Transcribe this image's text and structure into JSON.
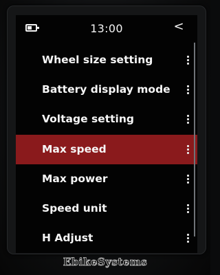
{
  "status_bar": {
    "time": "13:00",
    "battery_icon": "battery-icon",
    "back_icon": "chevron-left-icon",
    "back_glyph": "<"
  },
  "menu": {
    "items": [
      {
        "label": "Wheel size setting",
        "selected": false
      },
      {
        "label": "Battery display mode",
        "selected": false
      },
      {
        "label": "Voltage setting",
        "selected": false
      },
      {
        "label": "Max speed",
        "selected": true
      },
      {
        "label": "Max power",
        "selected": false
      },
      {
        "label": "Speed unit",
        "selected": false
      },
      {
        "label": "H Adjust",
        "selected": false
      }
    ],
    "more_icon": "vertical-dots-icon"
  },
  "colors": {
    "selected_row": "#8a1a1c",
    "text": "#f6f6f6",
    "screen_background": "#030303"
  },
  "watermark": "EbikeSystems"
}
